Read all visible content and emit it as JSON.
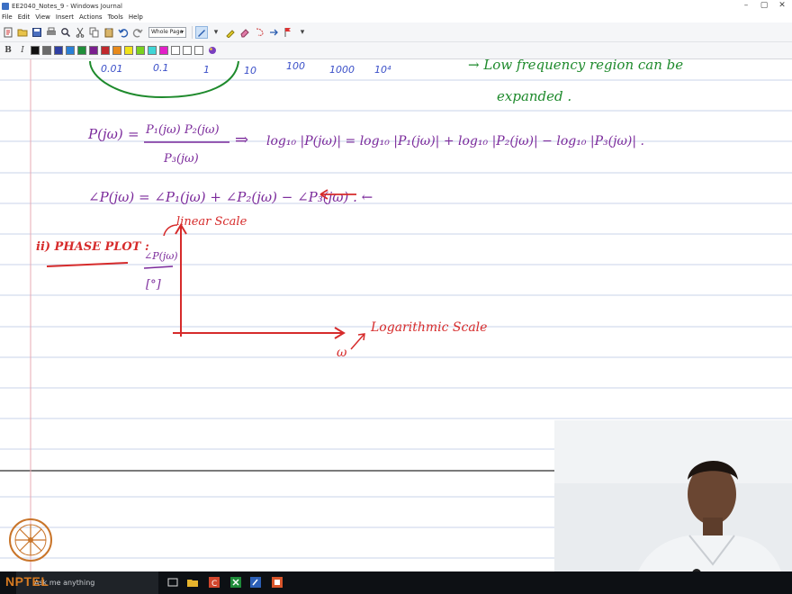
{
  "window": {
    "title": "EE2040_Notes_9 - Windows Journal",
    "controls": [
      "–",
      "▢",
      "✕"
    ]
  },
  "menu": [
    "File",
    "Edit",
    "View",
    "Insert",
    "Actions",
    "Tools",
    "Help"
  ],
  "toolbar": {
    "page_view_select": "Whole Page",
    "pen_colors": [
      "#111111",
      "#6b6b6b",
      "#2f3fa3",
      "#2a7fd6",
      "#1f8f3a",
      "#7a1f8f",
      "#c0282d",
      "#e88a1c",
      "#f0e21a",
      "#7ad21f",
      "#3fd6d6",
      "#e21fc8",
      "#ffffff",
      "#ffffff",
      "#ffffff"
    ]
  },
  "notes": {
    "ink_colors": {
      "purple": "#7b2a9b",
      "red": "#d62b2b",
      "green": "#1e8a2c",
      "blue": "#3a4fc8"
    },
    "top_row": {
      "tick_labels": [
        "0.01",
        "0.1",
        "1",
        "10",
        "100",
        "1000",
        "10⁴"
      ],
      "annotation_line1": "→ Low frequency region can be",
      "annotation_line2": "expanded ."
    },
    "equation1": {
      "lhs": "P(jω)",
      "eq": "=",
      "num": "P₁(jω) P₂(jω)",
      "den": "P₃(jω)",
      "implies": "⇒",
      "log_part": "log₁₀ |P(jω)| = log₁₀ |P₁(jω)| + log₁₀ |P₂(jω)| − log₁₀ |P₃(jω)| ."
    },
    "equation2": "∠P(jω) = ∠P₁(jω) + ∠P₂(jω) − ∠P₃(jω) . ←",
    "phase_plot": {
      "heading": "ii) PHASE PLOT :",
      "y_axis_label": "∠P(jω)",
      "y_unit": "[°]",
      "y_scale_note": "linear Scale",
      "x_axis_label": "ω",
      "x_scale_note": "Logarithmic Scale"
    }
  },
  "taskbar": {
    "search_placeholder": "Ask me anything"
  },
  "watermark": {
    "text": "NPTEL"
  }
}
